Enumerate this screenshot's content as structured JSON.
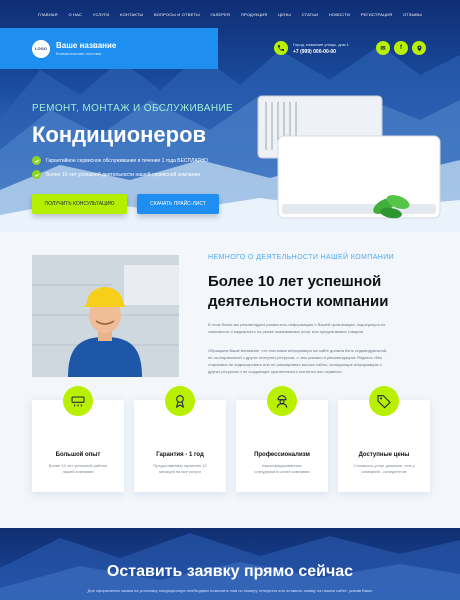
{
  "nav": [
    "ГЛАВНАЯ",
    "О НАС",
    "УСЛУГИ",
    "КОНТАКТЫ",
    "ВОПРОСЫ И ОТВЕТЫ",
    "ГАЛЕРЕЯ",
    "ПРОДУКЦИЯ",
    "ЦЕНЫ",
    "СТАТЬИ",
    "НОВОСТИ",
    "РЕГИСТРАЦИЯ",
    "ОТЗЫВЫ"
  ],
  "header": {
    "logo": "LOGO",
    "company_name": "Ваше название",
    "company_tagline": "Климатические системы",
    "city": "Город, название улицы, дом 1",
    "phone": "+7 (999) 000-00-00",
    "social_1": "f",
    "social_2": "✉"
  },
  "hero": {
    "kicker": "РЕМОНТ, МОНТАЖ И ОБСЛУЖИВАНИЕ",
    "title": "Кондиционеров",
    "feature_1": "Гарантийное сервисное обслуживание в течение 1 года БЕСПЛАТНО",
    "feature_2": "Более 10 лет успешной деятельности нашей сервисной компании",
    "cta_primary": "ПОЛУЧИТЬ КОНСУЛЬТАЦИЮ",
    "cta_secondary": "СКАЧАТЬ ПРАЙС-ЛИСТ"
  },
  "about": {
    "kicker": "НЕМНОГО О ДЕЯТЕЛЬНОСТИ НАШЕЙ КОМПАНИИ",
    "title_line1": "Более 10 лет успешной",
    "title_line2": "деятельности компании",
    "para1_line1": "В этом блоке мы рекомендуем разместить информацию о Вашей организации, подчеркнуть ее",
    "para1_line2": "значимость и надежность на рынке оказываемых услуг или предлагаемых товаров.",
    "para2_line1": "Обращаем Ваше внимание, что текстовая информация на сайте должна быть индивидуальной,",
    "para2_line2": "не скопированной с других интернет-ресурсов, о чем указано в рекомендациях Яндекса «Мы",
    "para2_line3": "стараемся не индексировать или не ранжировать высоко сайты, копирующие информацию с",
    "para2_line4": "других ресурсов и не создающие оригинального контента или сервиса»."
  },
  "cards": [
    {
      "title": "Большой опыт",
      "line1": "Более 10 лет успешной работы",
      "line2": "нашей компании"
    },
    {
      "title": "Гарантия - 1 год",
      "line1": "Предоставляем гарантию 12",
      "line2": "месяцев на все услуги"
    },
    {
      "title": "Профессионализм",
      "line1": "Квалифицированные",
      "line2": "сотрудники в штате компании"
    },
    {
      "title": "Доступные цены",
      "line1": "Стоимость услуг дешевле, чем у",
      "line2": "компаний - конкурентов"
    }
  ],
  "request": {
    "title": "Оставить заявку прямо сейчас",
    "desc": "Для оформления заказа на установку кондиционера необходимо позвонить нам по номеру телефона или оставить заявку на нашем сайте, указав Ваше"
  },
  "colors": {
    "accent": "#b8f000",
    "blue": "#1e8ff0",
    "hero_dark": "#0f2e74"
  }
}
